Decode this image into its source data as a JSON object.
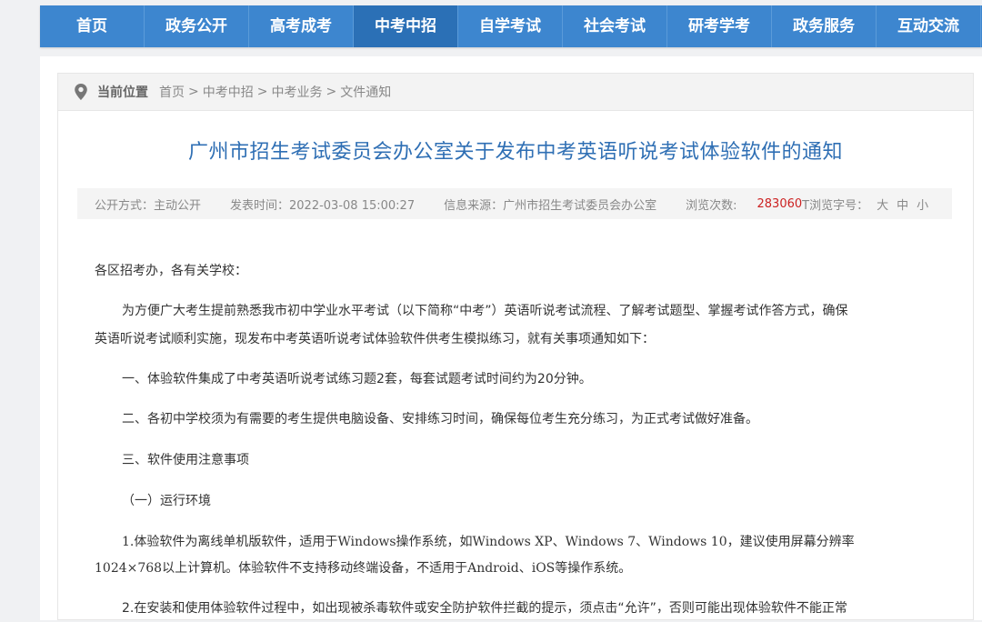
{
  "nav": {
    "items": [
      "首页",
      "政务公开",
      "高考成考",
      "中考中招",
      "自学考试",
      "社会考试",
      "研考学考",
      "政务服务",
      "互动交流"
    ],
    "active_index": 3
  },
  "breadcrumb": {
    "label": "当前位置",
    "items": [
      "首页",
      "中考中招",
      "中考业务",
      "文件通知"
    ],
    "separator": ">"
  },
  "article": {
    "title": "广州市招生考试委员会办公室关于发布中考英语听说考试体验软件的通知",
    "meta": {
      "publish_mode": "公开方式：主动公开",
      "publish_time": "发表时间：2022-03-08 15:00:27",
      "source": "信息来源：广州市招生考试委员会办公室",
      "views_label": "浏览次数:",
      "views_count": "283060",
      "font_size_label": "T浏览字号：",
      "font_large": "大",
      "font_medium": "中",
      "font_small": "小"
    },
    "paragraphs": {
      "salutation": "各区招考办，各有关学校：",
      "intro_line1": "为方便广大考生提前熟悉我市初中学业水平考试（以下简称“中考”）英语听说考试流程、了解考试题型、掌握考试作答方式，确保",
      "intro_line2": "英语听说考试顺利实施，现发布中考英语听说考试体验软件供考生模拟练习，就有关事项通知如下：",
      "item1": "一、体验软件集成了中考英语听说考试练习题2套，每套试题考试时间约为20分钟。",
      "item2": "二、各初中学校须为有需要的考生提供电脑设备、安排练习时间，确保每位考生充分练习，为正式考试做好准备。",
      "item3": "三、软件使用注意事项",
      "sub1": "（一）运行环境",
      "env1_line1": "1.体验软件为离线单机版软件，适用于Windows操作系统，如Windows XP、Windows 7、Windows 10，建议使用屏幕分辨率",
      "env1_line2": "1024×768以上计算机。体验软件不支持移动终端设备，不适用于Android、iOS等操作系统。",
      "env2_partial": "2.在安装和使用体验软件过程中，如出现被杀毒软件或安全防护软件拦截的提示，须点击“允许”，否则可能出现体验软件不能正常"
    }
  },
  "colors": {
    "nav_bg": "#3d86cf",
    "nav_active": "#2b70b6",
    "title": "#2f6fb4",
    "views": "#cc2222"
  }
}
